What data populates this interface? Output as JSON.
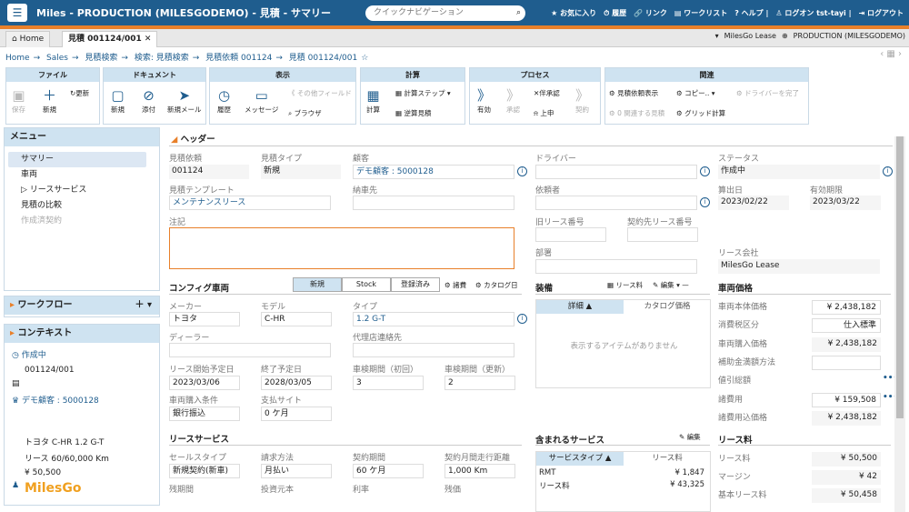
{
  "app": {
    "title": "Miles - PRODUCTION (MILESGODEMO) - 見積 - サマリー",
    "search_placeholder": "クイックナビゲーション"
  },
  "toplinks": [
    "★ お気に入り",
    "⏱ 履歴",
    "🔗 リンク",
    "▤ ワークリスト",
    "? ヘルプ |",
    "♙ ログオン tst-tayi |",
    "⇥ ログアウト"
  ],
  "tabs": {
    "home": "Home",
    "quote": "見積 001124/001",
    "company": "MilesGo Lease",
    "env": "PRODUCTION (MILESGODEMO)"
  },
  "breadcrumb": [
    "Home",
    "→",
    "Sales",
    "→",
    "見積検索",
    "→",
    "検索: 見積検索",
    "→",
    "見積依頼 001124",
    "→",
    "見積 001124/001"
  ],
  "ribbon": {
    "file": {
      "title": "ファイル",
      "save": "保存",
      "new": "新規",
      "refresh": "更新"
    },
    "document": {
      "title": "ドキュメント",
      "new": "新規",
      "attach": "添付",
      "newmail": "新規メール"
    },
    "display": {
      "title": "表示",
      "history": "履歴",
      "message": "メッセージ",
      "other": "その他フィールド",
      "browser": "ブラウザ"
    },
    "calc": {
      "title": "計算",
      "calc": "計算",
      "step": "計算ステップ",
      "reverse": "逆算見積"
    },
    "process": {
      "title": "プロセス",
      "valid": "有効",
      "approve": "承認",
      "reject": "伴承認",
      "submit": "上申",
      "contract": "契約"
    },
    "related": {
      "title": "関連",
      "quote_view": "見積依頼表示",
      "copy": "コピー..",
      "driver_done": "ドライバーを完了",
      "related_quote": "0 関連する見積",
      "grid": "グリッド計算"
    }
  },
  "menu": {
    "title": "メニュー",
    "items": [
      "サマリー",
      "車両",
      "リースサービス",
      "見積の比較",
      "作成済契約"
    ]
  },
  "workflow": {
    "title": "ワークフロー"
  },
  "context": {
    "title": "コンテキスト",
    "status": "作成中",
    "number": "001124/001",
    "customer": "デモ顧客 : 5000128",
    "vehicle": "トヨタ C-HR 1.2 G-T",
    "lease": "リース 60/60,000 Km",
    "amount": "¥ 50,500",
    "logo": "MilesGo"
  },
  "header": {
    "title": "ヘッダー",
    "quote_req_label": "見積依頼",
    "quote_req": "001124",
    "quote_type_label": "見積タイプ",
    "quote_type": "新規",
    "customer_label": "顧客",
    "customer": "デモ顧客 : 5000128",
    "driver_label": "ドライバー",
    "driver": "",
    "status_label": "ステータス",
    "status": "作成中",
    "template_label": "見積テンプレート",
    "template": "メンテナンスリース",
    "delivery_label": "納車先",
    "delivery": "",
    "requester_label": "依頼者",
    "requester": "",
    "issue_label": "算出日",
    "issue": "2023/02/22",
    "valid_label": "有効期限",
    "valid": "2023/03/22",
    "note_label": "注記",
    "old_lease_label": "旧リース番号",
    "old_lease": "",
    "contract_lease_label": "契約先リース番号",
    "contract_lease": "",
    "dept_label": "部署",
    "dept": "",
    "lease_co_label": "リース会社",
    "lease_co": "MilesGo Lease"
  },
  "config": {
    "title": "コンフィグ車両",
    "seg": [
      "新規",
      "Stock",
      "登録済み"
    ],
    "opt1": "諸費",
    "opt2": "カタログ日",
    "maker_label": "メーカー",
    "maker": "トヨタ",
    "model_label": "モデル",
    "model": "C-HR",
    "type_label": "タイプ",
    "type": "1.2 G-T",
    "dealer_label": "ディーラー",
    "dealer": "",
    "agent_label": "代理店連絡先",
    "agent": "",
    "start_label": "リース開始予定日",
    "start": "2023/03/06",
    "end_label": "終了予定日",
    "end": "2028/03/05",
    "insp1_label": "車検期間（初回）",
    "insp1": "3",
    "insp2_label": "車検期間（更新）",
    "insp2": "2",
    "purchase_label": "車両購入条件",
    "purchase": "銀行振込",
    "pay_label": "支払サイト",
    "pay": "0 ケ月"
  },
  "equipment": {
    "title": "装備",
    "lease": "リース料",
    "edit": "編集",
    "col1": "詳細",
    "col2": "カタログ価格",
    "empty": "表示するアイテムがありません"
  },
  "price": {
    "title": "車両価格",
    "rows": [
      {
        "label": "車両本体価格",
        "value": "¥ 2,438,182"
      },
      {
        "label": "消費税区分",
        "value": "仕入標準"
      },
      {
        "label": "車両購入価格",
        "value": "¥ 2,438,182"
      },
      {
        "label": "補助金満額方法",
        "value": ""
      },
      {
        "label": "値引総額",
        "value": ""
      },
      {
        "label": "諸費用",
        "value": "¥ 159,508"
      },
      {
        "label": "諸費用込価格",
        "value": "¥ 2,438,182"
      }
    ]
  },
  "lease_service": {
    "title": "リースサービス",
    "labels": [
      "セールスタイプ",
      "請求方法",
      "契約期間",
      "契約月間走行距離"
    ],
    "values": [
      "新規契約(新車)",
      "月払い",
      "60 ケ月",
      "1,000 Km"
    ],
    "labels2": [
      "残期間",
      "投資元本",
      "利率",
      "残価"
    ]
  },
  "included": {
    "title": "含まれるサービス",
    "edit": "編集",
    "col1": "サービスタイプ",
    "col2": "リース料",
    "rows": [
      {
        "name": "RMT",
        "value": "¥ 1,847"
      },
      {
        "name": "リース料",
        "value": "¥ 43,325"
      }
    ]
  },
  "lease_fee": {
    "title": "リース料",
    "rows": [
      {
        "label": "リース料",
        "value": "¥ 50,500"
      },
      {
        "label": "マージン",
        "value": "¥ 42"
      },
      {
        "label": "基本リース料",
        "value": "¥ 50,458"
      }
    ]
  }
}
